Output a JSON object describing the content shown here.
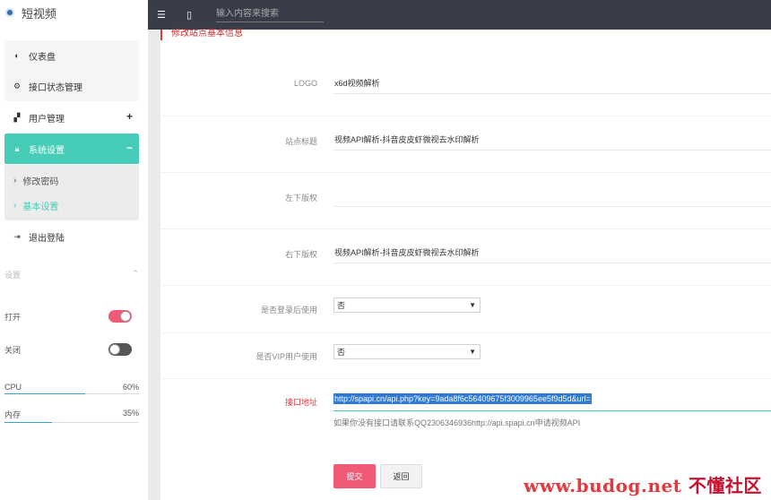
{
  "app": {
    "title": "短视频"
  },
  "sidebar": {
    "items": [
      {
        "label": "仪表盘",
        "icon": "dashboard-icon"
      },
      {
        "label": "接口状态管理",
        "icon": "gears-icon"
      },
      {
        "label": "用户管理",
        "icon": "user-icon",
        "toggle": "+"
      },
      {
        "label": "系统设置",
        "icon": "lock-icon",
        "toggle": "−"
      },
      {
        "label": "退出登陆",
        "icon": "signout-icon"
      }
    ],
    "submenu": [
      {
        "label": "修改密码"
      },
      {
        "label": "基本设置"
      }
    ],
    "settings_title": "设置",
    "switches": [
      {
        "label": "打开",
        "state": "on"
      },
      {
        "label": "关闭",
        "state": "off"
      }
    ],
    "meters": [
      {
        "label": "CPU",
        "value_text": "60%",
        "value": 0.6
      },
      {
        "label": "内存",
        "value_text": "35%",
        "value": 0.35
      }
    ]
  },
  "topbar": {
    "search_placeholder": "输入内容来搜索"
  },
  "main": {
    "title": "修改站点基本信息",
    "fields": {
      "logo": {
        "label": "LOGO",
        "value": "x6d视频解析"
      },
      "site_title": {
        "label": "站点标题",
        "value": "视频API解析-抖音皮皮虾微视去水印解析"
      },
      "left_copyright": {
        "label": "左下版权",
        "value": ""
      },
      "right_copyright": {
        "label": "右下版权",
        "value": "视频API解析-抖音皮皮虾微视去水印解析"
      },
      "login_required": {
        "label": "是否登录后使用",
        "value": "否"
      },
      "vip_required": {
        "label": "是否VIP用户使用",
        "value": "否"
      },
      "api_url": {
        "label": "接口地址",
        "value": "http://spapi.cn/api.php?key=9ada8f6c56409675f3009965ee5f9d5d&url="
      }
    },
    "hint": "如果你没有接口请联系QQ2306346936http://api.spapi.cn申请视频API",
    "submit_label": "提交",
    "back_label": "返回"
  },
  "watermark": {
    "text": "www.budog.net",
    "cn": "不懂社区"
  }
}
